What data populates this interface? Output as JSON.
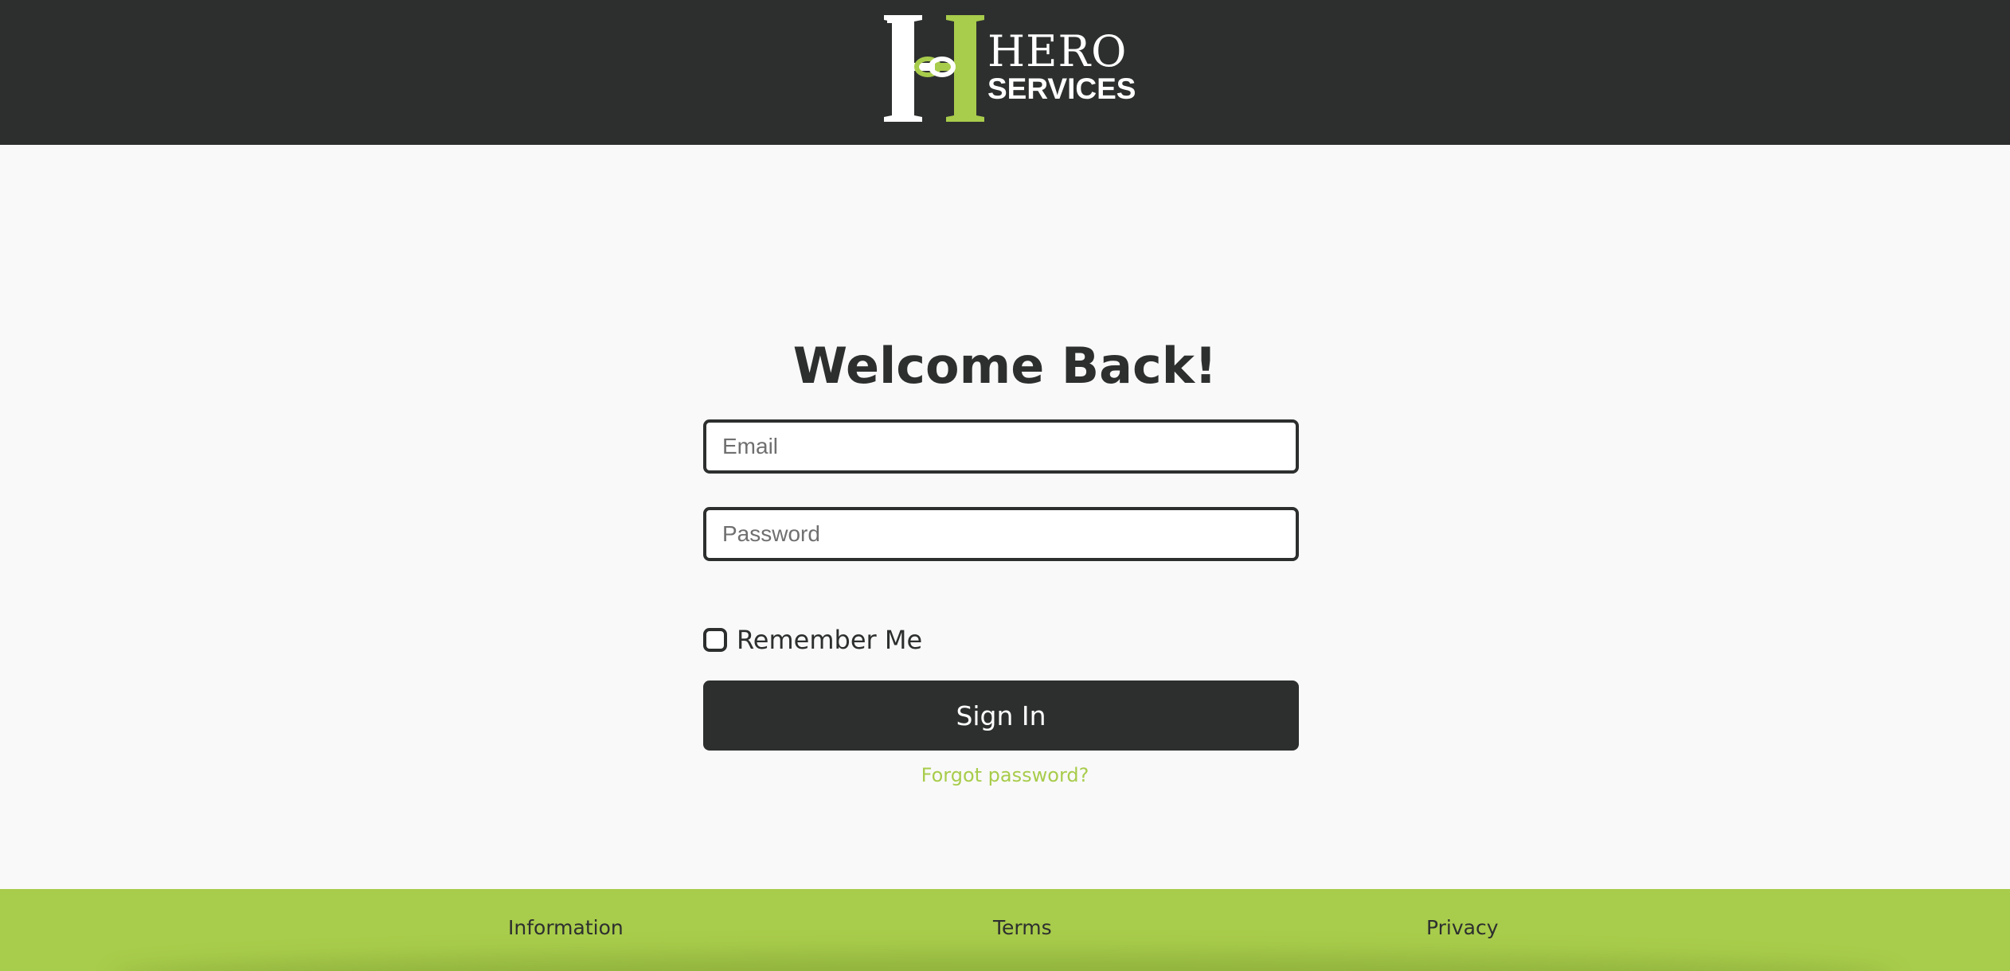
{
  "header": {
    "logo": {
      "line1": "HERO",
      "line2": "SERVICES",
      "letter_white_color": "#ffffff",
      "letter_green_color": "#a8cc4b"
    },
    "background_color": "#2d2f2f"
  },
  "login": {
    "title": "Welcome Back!",
    "email": {
      "value": "",
      "placeholder": "Email"
    },
    "password": {
      "value": "",
      "placeholder": "Password"
    },
    "remember_me": {
      "label": "Remember Me",
      "checked": false
    },
    "sign_in_label": "Sign In",
    "forgot_password_label": "Forgot password?"
  },
  "footer": {
    "links": [
      {
        "label": "Information"
      },
      {
        "label": "Terms"
      },
      {
        "label": "Privacy"
      }
    ],
    "background_color": "#a8cc4b"
  },
  "colors": {
    "dark": "#2d2f2f",
    "accent": "#a8cc4b",
    "page_background": "#f9f9f9"
  }
}
